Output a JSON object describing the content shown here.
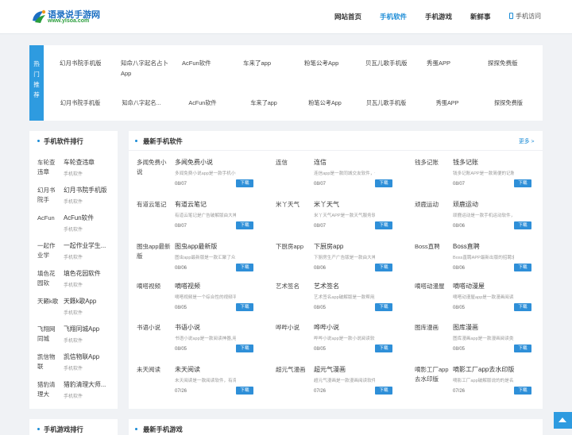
{
  "header": {
    "logo_cn": "语录说手游网",
    "logo_en": "www.ylsoa.com",
    "nav": [
      "网站首页",
      "手机软件",
      "手机游戏",
      "新鲜事"
    ],
    "mobile_visit": "手机访问",
    "accent_color": "#1a8bd6"
  },
  "hot": {
    "label": [
      "热",
      "门",
      "推",
      "荐"
    ],
    "items": [
      {
        "img_alt": "幻月书院手机版",
        "name": "幻月书院手机版"
      },
      {
        "img_alt": "知命八字起名占卜App",
        "name": "知命八字起名..."
      },
      {
        "img_alt": "AcFun软件",
        "name": "AcFun软件"
      },
      {
        "img_alt": "车来了app",
        "name": "车来了app"
      },
      {
        "img_alt": "粉笔公考App",
        "name": "粉笔公考App"
      },
      {
        "img_alt": "贝瓦儿歌手机版",
        "name": "贝瓦儿歌手机版"
      },
      {
        "img_alt": "秀蛋APP",
        "name": "秀蛋APP"
      },
      {
        "img_alt": "探探免费版",
        "name": "探探免费版"
      }
    ]
  },
  "ranking": {
    "title": "手机软件排行",
    "items": [
      {
        "img_alt": "车轮查违章",
        "name": "车轮查违章",
        "cat": "手机软件"
      },
      {
        "img_alt": "幻月书院手",
        "name": "幻月书院手机版",
        "cat": "手机软件"
      },
      {
        "img_alt": "AcFun",
        "name": "AcFun软件",
        "cat": "手机软件"
      },
      {
        "img_alt": "一起作业学",
        "name": "一起作业学生...",
        "cat": "手机软件"
      },
      {
        "img_alt": "填色花园软",
        "name": "填色花园软件",
        "cat": "手机软件"
      },
      {
        "img_alt": "天籁k歌",
        "name": "天籁k歌App",
        "cat": "手机软件"
      },
      {
        "img_alt": "飞翔网同城",
        "name": "飞翔同城App",
        "cat": "手机软件"
      },
      {
        "img_alt": "凯信物联",
        "name": "凯信物联App",
        "cat": "手机软件"
      },
      {
        "img_alt": "猎豹清理大",
        "name": "猎豹清理大师...",
        "cat": "手机软件"
      }
    ]
  },
  "latest": {
    "title": "最新手机软件",
    "more": "更多 >",
    "download_label": "下载",
    "items": [
      {
        "img_alt": "多闻免费小说",
        "name": "多闻免费小说",
        "desc": "多闻免费小说app是一款手机小说阅读软件",
        "date": "08/07"
      },
      {
        "img_alt": "连信",
        "name": "连信",
        "desc": "连信app是一款同城交友软件，你可以在这里",
        "date": "08/07"
      },
      {
        "img_alt": "钱多记账",
        "name": "钱多记账",
        "desc": "钱多记账APP是一款简便的记账软件",
        "date": "08/07"
      },
      {
        "img_alt": "有道云笔记",
        "name": "有道云笔记",
        "desc": "有道云笔记是广告破解版由大神(画)",
        "date": "08/07"
      },
      {
        "img_alt": "米丫天气",
        "name": "米丫天气",
        "desc": "米丫天气APP是一款天气服务软件",
        "date": "08/07"
      },
      {
        "img_alt": "顽鹿运动",
        "name": "顽鹿运动",
        "desc": "顽鹿运动是一款手机运动软件，软件",
        "date": "08/06"
      },
      {
        "img_alt": "图虫app最新版",
        "name": "图虫app最新版",
        "desc": "图虫app最新版是一款汇聚了众多摄影",
        "date": "08/06"
      },
      {
        "img_alt": "下厨房app",
        "name": "下厨房app",
        "desc": "下厨房生产广告版是一款由大神(同)子",
        "date": "08/06"
      },
      {
        "img_alt": "Boss直聘",
        "name": "Boss直聘",
        "desc": "Boss直聘APP最新出版的招聘求职",
        "date": "08/06"
      },
      {
        "img_alt": "嘀嗒视频",
        "name": "嘀嗒视频",
        "desc": "嘀嗒视频是一个综合性的视频平台",
        "date": "08/05"
      },
      {
        "img_alt": "艺术签名",
        "name": "艺术签名",
        "desc": "艺术签名app破解版是一款帮用户设计",
        "date": "08/05"
      },
      {
        "img_alt": "嘀嗒动漫屋",
        "name": "嘀嗒动漫屋",
        "desc": "嘀嗒动漫屋app是一款漫画阅读软件",
        "date": "08/05"
      },
      {
        "img_alt": "书语小说",
        "name": "书语小说",
        "desc": "书语小说app是一款阅读神器,用户",
        "date": "08/05"
      },
      {
        "img_alt": "哗哔小说",
        "name": "哗哔小说",
        "desc": "哗哔小说app是一款小说阅读软件，适",
        "date": "08/05"
      },
      {
        "img_alt": "图库漫画",
        "name": "图库漫画",
        "desc": "图库漫画app是一款漫画阅读类的软件",
        "date": "08/05"
      },
      {
        "img_alt": "未天阅读",
        "name": "未天阅读",
        "desc": "未天阅读是一款阅读软件，有海量",
        "date": "07/26"
      },
      {
        "img_alt": "超元气漫画",
        "name": "超元气漫画",
        "desc": "超元气漫画是一款漫画阅读软件",
        "date": "07/26"
      },
      {
        "img_alt": "嘀影工厂app去水印版",
        "name": "嘀影工厂app去水印版",
        "desc": "嘀影工厂app破解版说的的是名片片",
        "date": "07/26"
      }
    ]
  },
  "bottom": {
    "left_title": "手机游戏排行",
    "main_title": "最新手机游戏"
  }
}
